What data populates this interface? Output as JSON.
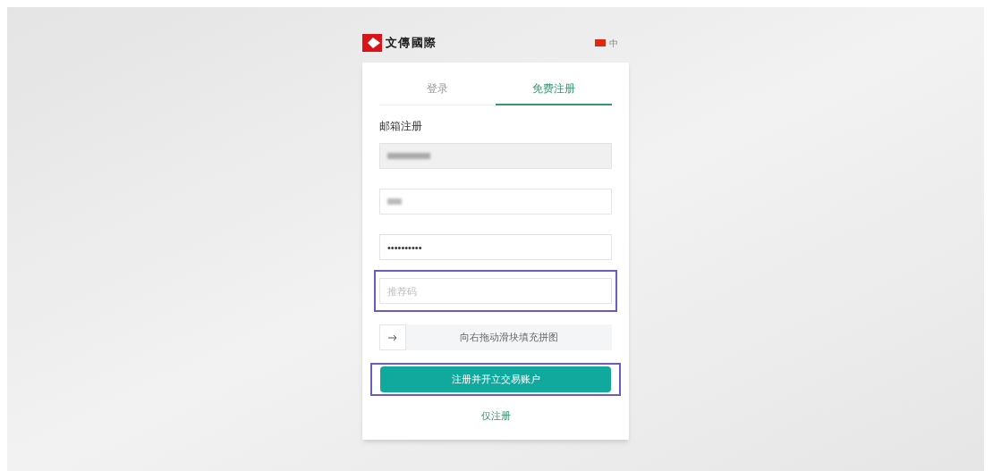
{
  "brand": {
    "name": "文傳國際"
  },
  "language": {
    "label": "中"
  },
  "tabs": [
    {
      "label": "登录",
      "selected": false
    },
    {
      "label": "免费注册",
      "selected": true
    }
  ],
  "form": {
    "heading": "邮箱注册",
    "fields": [
      {
        "kind": "redacted",
        "disabled": true,
        "highlighted": false
      },
      {
        "kind": "redacted",
        "disabled": false,
        "highlighted": false
      },
      {
        "kind": "password",
        "value": "••••••••••",
        "disabled": false,
        "highlighted": false
      },
      {
        "kind": "text",
        "placeholder": "推荐码",
        "disabled": false,
        "highlighted": true
      }
    ],
    "slider": {
      "label": "向右拖动滑块填充拼图"
    },
    "submit": {
      "label": "注册并开立交易账户",
      "highlighted": true
    },
    "link": {
      "label": "仅注册"
    }
  }
}
